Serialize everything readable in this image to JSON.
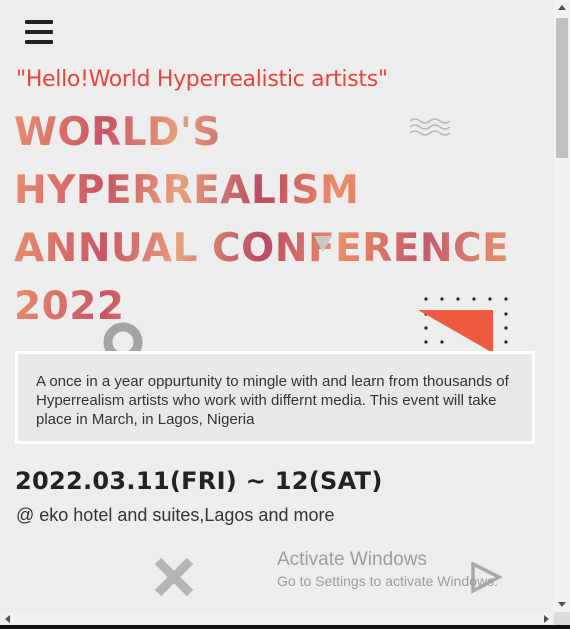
{
  "menu": {
    "icon": "hamburger-menu-icon"
  },
  "hero": {
    "tagline": "\"Hello!World Hyperrealistic artists\"",
    "title_lines": [
      "WORLD'S",
      "HYPERREALISM",
      "ANNUAL CONFERENCE",
      "2022"
    ]
  },
  "description": "A once in a year oppurtunity to mingle with and learn from thousands of Hyperrealism artists who work with differnt media. This event will take place in March, in Lagos, Nigeria",
  "event": {
    "date": "2022.03.11(FRI) ~ 12(SAT)",
    "venue": "@ eko hotel and suites,Lagos and more"
  },
  "watermark": {
    "title": "Activate Windows",
    "subtitle": "Go to Settings to activate Windows."
  },
  "colors": {
    "accent": "#e8453c",
    "background": "#ededed",
    "text": "#222222"
  },
  "icons": [
    "hamburger-menu-icon",
    "waves-icon",
    "chevron-down-icon",
    "ring-icon",
    "dot-grid-icon",
    "triangle-icon",
    "x-mark-icon",
    "play-icon"
  ]
}
